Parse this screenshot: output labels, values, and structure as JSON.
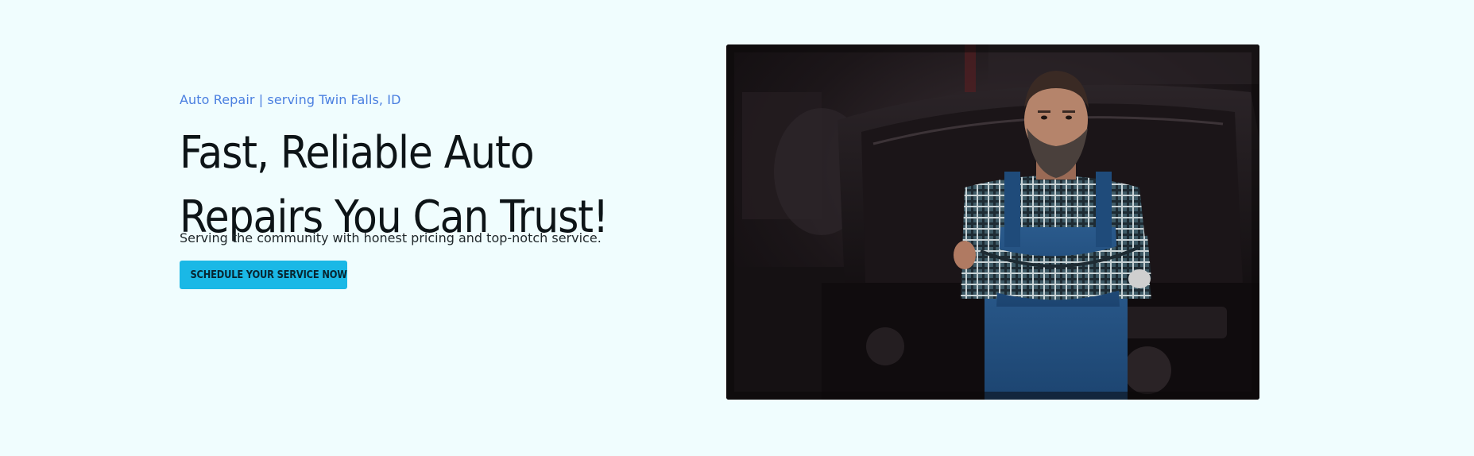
{
  "hero": {
    "eyebrow": "Auto Repair | serving Twin Falls, ID",
    "headline_line1": "Fast, Reliable Auto",
    "headline_line2": "Repairs You Can Trust!",
    "subtext": "Serving the community with honest pricing and top-notch service.",
    "cta_label": "SCHEDULE YOUR SERVICE NOW"
  },
  "colors": {
    "background": "#f0fdfe",
    "accent": "#1ab8e6",
    "eyebrow": "#4a7fe0",
    "headline": "#0d1417"
  },
  "image": {
    "subject": "mechanic-photo"
  }
}
